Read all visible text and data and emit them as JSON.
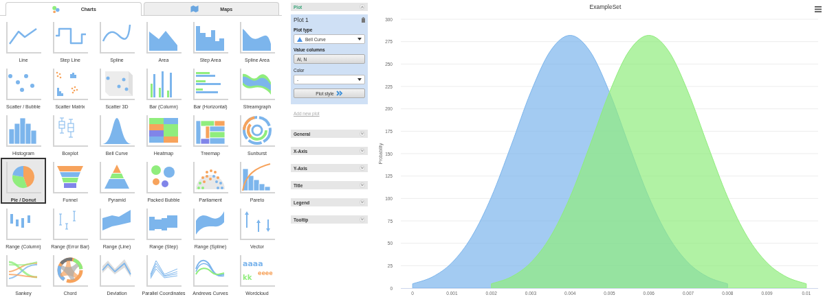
{
  "tabs": [
    {
      "label": "Charts",
      "selected": true
    },
    {
      "label": "Maps",
      "selected": false
    }
  ],
  "chart_types": [
    {
      "label": "Line",
      "selected": false
    },
    {
      "label": "Step Line",
      "selected": false
    },
    {
      "label": "Spline",
      "selected": false
    },
    {
      "label": "Area",
      "selected": false
    },
    {
      "label": "Step Area",
      "selected": false
    },
    {
      "label": "Spline Area",
      "selected": false
    },
    {
      "label": "Scatter / Bubble",
      "selected": false
    },
    {
      "label": "Scatter Matrix",
      "selected": false
    },
    {
      "label": "Scatter 3D",
      "selected": false
    },
    {
      "label": "Bar (Column)",
      "selected": false
    },
    {
      "label": "Bar (Horizontal)",
      "selected": false
    },
    {
      "label": "Streamgraph",
      "selected": false
    },
    {
      "label": "Histogram",
      "selected": false
    },
    {
      "label": "Boxplot",
      "selected": false
    },
    {
      "label": "Bell Curve",
      "selected": false
    },
    {
      "label": "Heatmap",
      "selected": false
    },
    {
      "label": "Treemap",
      "selected": false
    },
    {
      "label": "Sunburst",
      "selected": false
    },
    {
      "label": "Pie / Donut",
      "selected": true
    },
    {
      "label": "Funnel",
      "selected": false
    },
    {
      "label": "Pyramid",
      "selected": false
    },
    {
      "label": "Packed Bubble",
      "selected": false
    },
    {
      "label": "Parliament",
      "selected": false
    },
    {
      "label": "Pareto",
      "selected": false
    },
    {
      "label": "Range (Column)",
      "selected": false
    },
    {
      "label": "Range (Error Bar)",
      "selected": false
    },
    {
      "label": "Range (Line)",
      "selected": false
    },
    {
      "label": "Range (Step)",
      "selected": false
    },
    {
      "label": "Range (Spline)",
      "selected": false
    },
    {
      "label": "Vector",
      "selected": false
    },
    {
      "label": "Sankey",
      "selected": false
    },
    {
      "label": "Chord",
      "selected": false
    },
    {
      "label": "Deviation",
      "selected": false
    },
    {
      "label": "Parallel Coordinates",
      "selected": false
    },
    {
      "label": "Andrews Curves",
      "selected": false
    },
    {
      "label": "Wordcloud",
      "selected": false
    }
  ],
  "wordcloud_icon_words": [
    "aaaa",
    "kk",
    "eeee"
  ],
  "settings": {
    "sections": [
      {
        "title": "Plot",
        "expanded": true
      },
      {
        "title": "General",
        "expanded": false
      },
      {
        "title": "X-Axis",
        "expanded": false
      },
      {
        "title": "Y-Axis",
        "expanded": false
      },
      {
        "title": "Title",
        "expanded": false
      },
      {
        "title": "Legend",
        "expanded": false
      },
      {
        "title": "Tooltip",
        "expanded": false
      }
    ],
    "plot": {
      "title": "Plot 1",
      "plot_type_label": "Plot type",
      "plot_type": "Bell Curve",
      "value_columns_label": "Value columns",
      "value_columns": "Al, N",
      "color_label": "Color",
      "color_choice": "-",
      "style_button": "Plot style"
    },
    "add_plot_link": "Add new plot"
  },
  "chart": {
    "chart_data": {
      "type": "area",
      "grid": true,
      "title": "ExampleSet",
      "ylabel": "Probability",
      "x": [
        0,
        0.0005,
        0.001,
        0.0015,
        0.002,
        0.0025,
        0.003,
        0.0035,
        0.004,
        0.0045,
        0.005,
        0.0055,
        0.006,
        0.0065,
        0.007,
        0.0075,
        0.008,
        0.0085,
        0.009,
        0.0095,
        0.01
      ],
      "series": [
        {
          "color": "#7cb5ec",
          "values": [
            4.8,
            12.4,
            28.4,
            57.3,
            101.6,
            158.8,
            218.5,
            264.6,
            282,
            264.6,
            218.5,
            158.8,
            101.6,
            57.3,
            28.4,
            12.4,
            4.8,
            null,
            null,
            null,
            null
          ]
        },
        {
          "color": "#90ed7d",
          "values": [
            null,
            null,
            null,
            null,
            4.8,
            12.4,
            28.4,
            57.3,
            101.6,
            158.8,
            218.5,
            264.6,
            282,
            264.6,
            218.5,
            158.8,
            101.6,
            57.3,
            28.4,
            12.4,
            4.8
          ]
        }
      ],
      "xlim": [
        -0.0003,
        0.0103
      ],
      "ylim": [
        0,
        300
      ],
      "xticks": [
        0,
        0.001,
        0.002,
        0.003,
        0.004,
        0.005,
        0.006,
        0.007,
        0.008,
        0.009,
        0.01
      ],
      "yticks": [
        0,
        25,
        50,
        75,
        100,
        125,
        150,
        175,
        200,
        225,
        250,
        275,
        300
      ]
    }
  }
}
